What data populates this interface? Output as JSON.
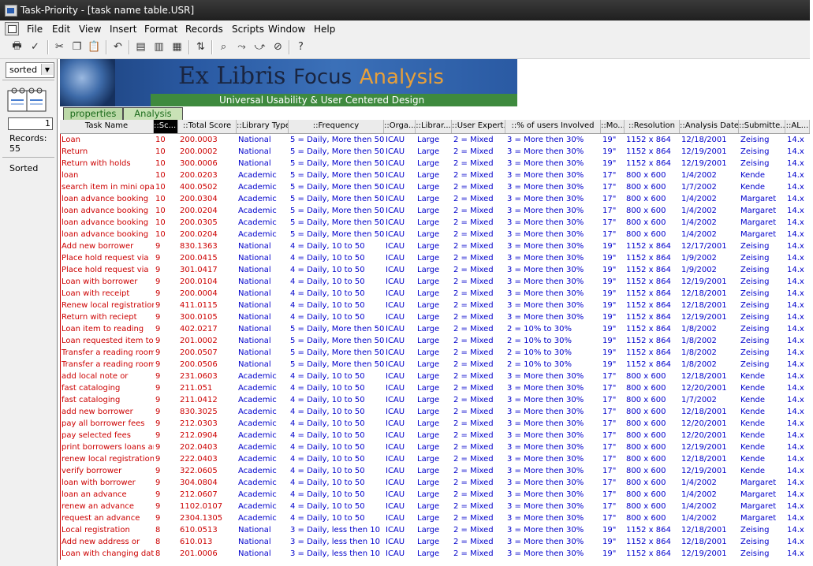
{
  "window": {
    "title": "Task-Priority - [task name table.USR]"
  },
  "menu": [
    "File",
    "Edit",
    "View",
    "Insert",
    "Format",
    "Records",
    "Scripts",
    "Window",
    "Help"
  ],
  "toolbar_icons": [
    "print-icon",
    "spellcheck-icon",
    "cut-icon",
    "copy-icon",
    "paste-icon",
    "undo-icon",
    "new-record-icon",
    "duplicate-record-icon",
    "delete-record-icon",
    "sort-icon",
    "find-icon",
    "find-next-icon",
    "find-all-icon",
    "omit-icon",
    "help-icon"
  ],
  "left_panel": {
    "layout_select": "sorted",
    "record_number": "1",
    "records_label": "Records:",
    "records_count": "55",
    "sort_status": "Sorted"
  },
  "banner": {
    "brand_main": "Ex Libris",
    "brand_focus": "Focus",
    "brand_analysis": "Analysis",
    "tagline": "Universal Usability & User Centered Design"
  },
  "tabs": [
    "properties",
    "Analysis"
  ],
  "columns": [
    "Task Name",
    "::Sc...",
    "::Total Score",
    "::Library Type",
    "::Frequency",
    "::Orga...",
    "::Librar...",
    "::User Expert...",
    "::% of users Involved",
    "::Mo...",
    "::Resolution",
    "::Analysis Date",
    "::Submitte...",
    "::AL..."
  ],
  "rows": [
    [
      "Loan",
      "10",
      "200.0003",
      "National",
      "5 = Daily, More then 50",
      "ICAU",
      "Large",
      "2 = Mixed",
      "3 = More then 30%",
      "19\"",
      "1152 x 864",
      "12/18/2001",
      "Zeising",
      "14.x"
    ],
    [
      "Return",
      "10",
      "200.0002",
      "National",
      "5 = Daily, More then 50",
      "ICAU",
      "Large",
      "2 = Mixed",
      "3 = More then 30%",
      "19\"",
      "1152 x 864",
      "12/19/2001",
      "Zeising",
      "14.x"
    ],
    [
      "Return with holds",
      "10",
      "300.0006",
      "National",
      "5 = Daily, More then 50",
      "ICAU",
      "Large",
      "2 = Mixed",
      "3 = More then 30%",
      "19\"",
      "1152 x 864",
      "12/19/2001",
      "Zeising",
      "14.x"
    ],
    [
      "loan",
      "10",
      "200.0203",
      "Academic",
      "5 = Daily, More then 50",
      "ICAU",
      "Large",
      "2 = Mixed",
      "3 = More then 30%",
      "17\"",
      "800 x 600",
      "1/4/2002",
      "Kende",
      "14.x"
    ],
    [
      "search item in mini opac",
      "10",
      "400.0502",
      "Academic",
      "5 = Daily, More then 50",
      "ICAU",
      "Large",
      "2 = Mixed",
      "3 = More then 30%",
      "17\"",
      "800 x 600",
      "1/7/2002",
      "Kende",
      "14.x"
    ],
    [
      "loan advance booking",
      "10",
      "200.0304",
      "Academic",
      "5 = Daily, More then 50",
      "ICAU",
      "Large",
      "2 = Mixed",
      "3 = More then 30%",
      "17\"",
      "800 x 600",
      "1/4/2002",
      "Margaret",
      "14.x"
    ],
    [
      "loan advance booking",
      "10",
      "200.0204",
      "Academic",
      "5 = Daily, More then 50",
      "ICAU",
      "Large",
      "2 = Mixed",
      "3 = More then 30%",
      "17\"",
      "800 x 600",
      "1/4/2002",
      "Margaret",
      "14.x"
    ],
    [
      "loan advance booking",
      "10",
      "200.0305",
      "Academic",
      "5 = Daily, More then 50",
      "ICAU",
      "Large",
      "2 = Mixed",
      "3 = More then 30%",
      "17\"",
      "800 x 600",
      "1/4/2002",
      "Margaret",
      "14.x"
    ],
    [
      "loan advance booking",
      "10",
      "200.0204",
      "Academic",
      "5 = Daily, More then 50",
      "ICAU",
      "Large",
      "2 = Mixed",
      "3 = More then 30%",
      "17\"",
      "800 x 600",
      "1/4/2002",
      "Margaret",
      "14.x"
    ],
    [
      "Add new borrower",
      "9",
      "830.1363",
      "National",
      "4 = Daily, 10 to 50",
      "ICAU",
      "Large",
      "2 = Mixed",
      "3 = More then 30%",
      "19\"",
      "1152 x 864",
      "12/17/2001",
      "Zeising",
      "14.x"
    ],
    [
      "Place hold request via",
      "9",
      "200.0415",
      "National",
      "4 = Daily, 10 to 50",
      "ICAU",
      "Large",
      "2 = Mixed",
      "3 = More then 30%",
      "19\"",
      "1152 x 864",
      "1/9/2002",
      "Zeising",
      "14.x"
    ],
    [
      "Place hold request via",
      "9",
      "301.0417",
      "National",
      "4 = Daily, 10 to 50",
      "ICAU",
      "Large",
      "2 = Mixed",
      "3 = More then 30%",
      "19\"",
      "1152 x 864",
      "1/9/2002",
      "Zeising",
      "14.x"
    ],
    [
      "Loan with borrower",
      "9",
      "200.0104",
      "National",
      "4 = Daily, 10 to 50",
      "ICAU",
      "Large",
      "2 = Mixed",
      "3 = More then 30%",
      "19\"",
      "1152 x 864",
      "12/19/2001",
      "Zeising",
      "14.x"
    ],
    [
      "Loan with receipt",
      "9",
      "200.0004",
      "National",
      "4 = Daily, 10 to 50",
      "ICAU",
      "Large",
      "2 = Mixed",
      "3 = More then 30%",
      "19\"",
      "1152 x 864",
      "12/18/2001",
      "Zeising",
      "14.x"
    ],
    [
      "Renew local registration",
      "9",
      "411.0115",
      "National",
      "4 = Daily, 10 to 50",
      "ICAU",
      "Large",
      "2 = Mixed",
      "3 = More then 30%",
      "19\"",
      "1152 x 864",
      "12/18/2001",
      "Zeising",
      "14.x"
    ],
    [
      "Return with reciept",
      "9",
      "300.0105",
      "National",
      "4 = Daily, 10 to 50",
      "ICAU",
      "Large",
      "2 = Mixed",
      "3 = More then 30%",
      "19\"",
      "1152 x 864",
      "12/19/2001",
      "Zeising",
      "14.x"
    ],
    [
      "Loan item to reading",
      "9",
      "402.0217",
      "National",
      "5 = Daily, More then 50",
      "ICAU",
      "Large",
      "2 = Mixed",
      "2 = 10% to 30%",
      "19\"",
      "1152 x 864",
      "1/8/2002",
      "Zeising",
      "14.x"
    ],
    [
      "Loan requested item to",
      "9",
      "201.0002",
      "National",
      "5 = Daily, More then 50",
      "ICAU",
      "Large",
      "2 = Mixed",
      "2 = 10% to 30%",
      "19\"",
      "1152 x 864",
      "1/8/2002",
      "Zeising",
      "14.x"
    ],
    [
      "Transfer a reading room",
      "9",
      "200.0507",
      "National",
      "5 = Daily, More then 50",
      "ICAU",
      "Large",
      "2 = Mixed",
      "2 = 10% to 30%",
      "19\"",
      "1152 x 864",
      "1/8/2002",
      "Zeising",
      "14.x"
    ],
    [
      "Transfer a reading room",
      "9",
      "200.0506",
      "National",
      "5 = Daily, More then 50",
      "ICAU",
      "Large",
      "2 = Mixed",
      "2 = 10% to 30%",
      "19\"",
      "1152 x 864",
      "1/8/2002",
      "Zeising",
      "14.x"
    ],
    [
      "add local note or",
      "9",
      "231.0603",
      "Academic",
      "4 = Daily, 10 to 50",
      "ICAU",
      "Large",
      "2 = Mixed",
      "3 = More then 30%",
      "17\"",
      "800 x 600",
      "12/18/2001",
      "Kende",
      "14.x"
    ],
    [
      "fast cataloging",
      "9",
      "211.051",
      "Academic",
      "4 = Daily, 10 to 50",
      "ICAU",
      "Large",
      "2 = Mixed",
      "3 = More then 30%",
      "17\"",
      "800 x 600",
      "12/20/2001",
      "Kende",
      "14.x"
    ],
    [
      "fast cataloging",
      "9",
      "211.0412",
      "Academic",
      "4 = Daily, 10 to 50",
      "ICAU",
      "Large",
      "2 = Mixed",
      "3 = More then 30%",
      "17\"",
      "800 x 600",
      "1/7/2002",
      "Kende",
      "14.x"
    ],
    [
      "add new borrower",
      "9",
      "830.3025",
      "Academic",
      "4 = Daily, 10 to 50",
      "ICAU",
      "Large",
      "2 = Mixed",
      "3 = More then 30%",
      "17\"",
      "800 x 600",
      "12/18/2001",
      "Kende",
      "14.x"
    ],
    [
      "pay all borrower fees",
      "9",
      "212.0303",
      "Academic",
      "4 = Daily, 10 to 50",
      "ICAU",
      "Large",
      "2 = Mixed",
      "3 = More then 30%",
      "17\"",
      "800 x 600",
      "12/20/2001",
      "Kende",
      "14.x"
    ],
    [
      "pay selected fees",
      "9",
      "212.0904",
      "Academic",
      "4 = Daily, 10 to 50",
      "ICAU",
      "Large",
      "2 = Mixed",
      "3 = More then 30%",
      "17\"",
      "800 x 600",
      "12/20/2001",
      "Kende",
      "14.x"
    ],
    [
      "print borrowers loans and",
      "9",
      "202.0403",
      "Academic",
      "4 = Daily, 10 to 50",
      "ICAU",
      "Large",
      "2 = Mixed",
      "3 = More then 30%",
      "17\"",
      "800 x 600",
      "12/19/2001",
      "Kende",
      "14.x"
    ],
    [
      "renew local registration",
      "9",
      "222.0403",
      "Academic",
      "4 = Daily, 10 to 50",
      "ICAU",
      "Large",
      "2 = Mixed",
      "3 = More then 30%",
      "17\"",
      "800 x 600",
      "12/18/2001",
      "Kende",
      "14.x"
    ],
    [
      "verify borrower",
      "9",
      "322.0605",
      "Academic",
      "4 = Daily, 10 to 50",
      "ICAU",
      "Large",
      "2 = Mixed",
      "3 = More then 30%",
      "17\"",
      "800 x 600",
      "12/19/2001",
      "Kende",
      "14.x"
    ],
    [
      "loan with borrower",
      "9",
      "304.0804",
      "Academic",
      "4 = Daily, 10 to 50",
      "ICAU",
      "Large",
      "2 = Mixed",
      "3 = More then 30%",
      "17\"",
      "800 x 600",
      "1/4/2002",
      "Margaret",
      "14.x"
    ],
    [
      "loan an advance",
      "9",
      "212.0607",
      "Academic",
      "4 = Daily, 10 to 50",
      "ICAU",
      "Large",
      "2 = Mixed",
      "3 = More then 30%",
      "17\"",
      "800 x 600",
      "1/4/2002",
      "Margaret",
      "14.x"
    ],
    [
      "renew an advance",
      "9",
      "1102.0107",
      "Academic",
      "4 = Daily, 10 to 50",
      "ICAU",
      "Large",
      "2 = Mixed",
      "3 = More then 30%",
      "17\"",
      "800 x 600",
      "1/4/2002",
      "Margaret",
      "14.x"
    ],
    [
      "request an advance",
      "9",
      "2304.1305",
      "Academic",
      "4 = Daily, 10 to 50",
      "ICAU",
      "Large",
      "2 = Mixed",
      "3 = More then 30%",
      "17\"",
      "800 x 600",
      "1/4/2002",
      "Margaret",
      "14.x"
    ],
    [
      "Local registration",
      "8",
      "610.0513",
      "National",
      "3 = Daily, less then 10",
      "ICAU",
      "Large",
      "2 = Mixed",
      "3 = More then 30%",
      "19\"",
      "1152 x 864",
      "12/18/2001",
      "Zeising",
      "14.x"
    ],
    [
      "Add new address or",
      "8",
      "610.013",
      "National",
      "3 = Daily, less then 10",
      "ICAU",
      "Large",
      "2 = Mixed",
      "3 = More then 30%",
      "19\"",
      "1152 x 864",
      "12/18/2001",
      "Zeising",
      "14.x"
    ],
    [
      "Loan with changing date",
      "8",
      "201.0006",
      "National",
      "3 = Daily, less then 10",
      "ICAU",
      "Large",
      "2 = Mixed",
      "3 = More then 30%",
      "19\"",
      "1152 x 864",
      "12/19/2001",
      "Zeising",
      "14.x"
    ]
  ],
  "colors": {
    "task_name": "#cc0000",
    "score": "#cc0000",
    "values": "#0000cc",
    "banner_bg": "#2a5aa3",
    "tab_bg": "#bcd9a8"
  }
}
